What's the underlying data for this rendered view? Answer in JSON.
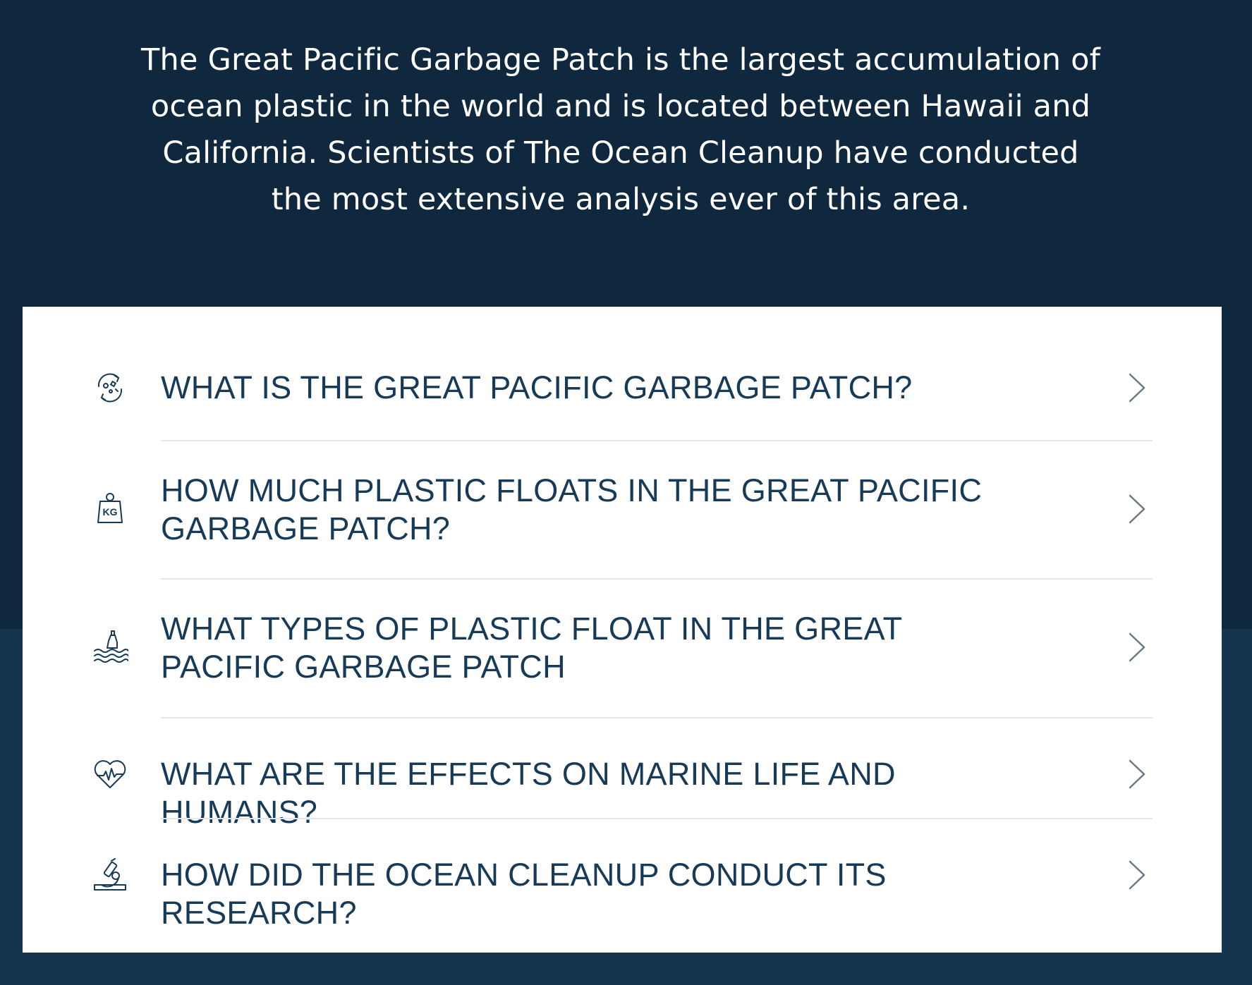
{
  "intro": {
    "text": "The Great Pacific Garbage Patch is the largest accumulation of ocean plastic in the world and is located between Hawaii and California. Scientists of The Ocean Cleanup have conducted the most extensive analysis ever of this area."
  },
  "faq": {
    "items": [
      {
        "label": "WHAT IS THE GREAT PACIFIC GARBAGE PATCH?",
        "icon": "rotating-debris-icon"
      },
      {
        "label": "HOW MUCH PLASTIC FLOATS IN THE GREAT PACIFIC GARBAGE PATCH?",
        "icon": "kg-weight-icon",
        "icon_text": "KG"
      },
      {
        "label": "WHAT TYPES OF PLASTIC FLOAT IN THE GREAT PACIFIC GARBAGE PATCH",
        "icon": "floating-bottle-icon"
      },
      {
        "label": "WHAT ARE THE EFFECTS ON MARINE LIFE AND HUMANS?",
        "icon": "heartbeat-icon"
      },
      {
        "label": "HOW DID THE OCEAN CLEANUP CONDUCT ITS RESEARCH?",
        "icon": "microscope-icon"
      }
    ],
    "chevron_icon": "chevron-right-icon"
  },
  "colors": {
    "top_background": "#10283d",
    "bottom_background": "#15344f",
    "card_background": "#ffffff",
    "heading_text": "#163a57",
    "chevron": "#6b7a86",
    "divider": "#e4e6e8"
  }
}
